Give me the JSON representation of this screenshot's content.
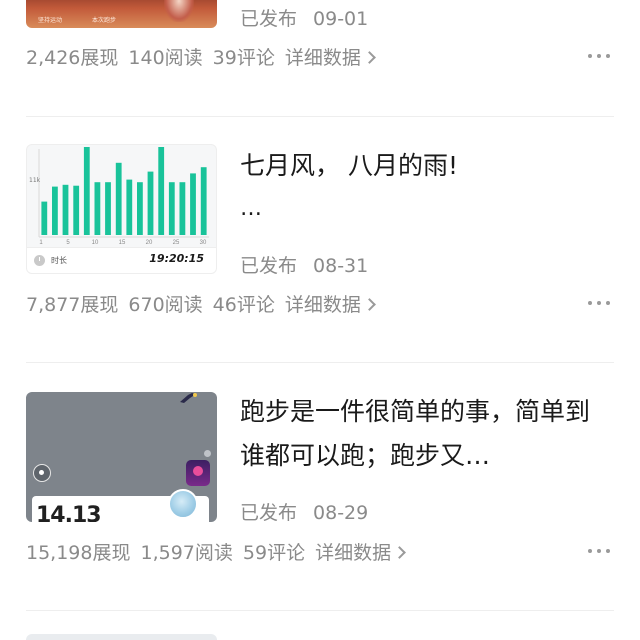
{
  "articles": [
    {
      "title": "",
      "thumb": {
        "caption_left": "坚持运动",
        "caption_right": "本次跑步"
      },
      "status": "已发布",
      "date": "09-01",
      "stats": {
        "views": "2,426展现",
        "reads": "140阅读",
        "comments": "39评论",
        "detail": "详细数据"
      }
    },
    {
      "title": "七月风，  八月的雨!",
      "title_more": "…",
      "thumb": {
        "y_axis_label": "11k",
        "x_ticks": [
          "1",
          "5",
          "10",
          "15",
          "20",
          "25",
          "30"
        ],
        "duration_label": "时长",
        "duration_value": "19:20:15",
        "bar_color": "#19c39a",
        "bar_heights": [
          0.38,
          0.55,
          0.57,
          0.56,
          1.0,
          0.6,
          0.6,
          0.82,
          0.63,
          0.6,
          0.72,
          1.0,
          0.6,
          0.6,
          0.7,
          0.77
        ]
      },
      "status": "已发布",
      "date": "08-31",
      "stats": {
        "views": "7,877展现",
        "reads": "670阅读",
        "comments": "46评论",
        "detail": "详细数据"
      }
    },
    {
      "title": "跑步是一件很简单的事，简单到谁都可以跑；跑步又…",
      "thumb": {
        "big_number": "14.13"
      },
      "status": "已发布",
      "date": "08-29",
      "stats": {
        "views": "15,198展现",
        "reads": "1,597阅读",
        "comments": "59评论",
        "detail": "详细数据"
      }
    }
  ],
  "icons": {
    "more": "more-dots-icon",
    "detail_arrow": "chevron-right-icon"
  },
  "colors": {
    "accent_green": "#19c39a",
    "muted_text": "#8a8a8a"
  }
}
